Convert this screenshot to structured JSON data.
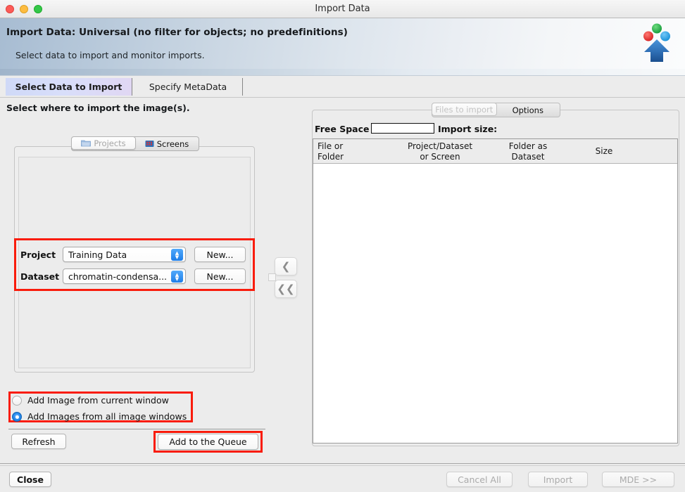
{
  "window": {
    "title": "Import Data",
    "traffic_lights": [
      "close-red",
      "minimize-yellow",
      "zoom-green"
    ]
  },
  "banner": {
    "title": "Import Data: Universal  (no filter for objects; no predefinitions)",
    "subtitle": "Select data to import and monitor imports.",
    "logo_name": "omero-logo"
  },
  "tabs": [
    {
      "label": "Select Data to Import",
      "selected": true
    },
    {
      "label": "Specify MetaData",
      "selected": false
    }
  ],
  "left": {
    "hint": "Select where to import the image(s).",
    "segmented": [
      {
        "label": "Projects",
        "icon": "folder-icon",
        "selected": true
      },
      {
        "label": "Screens",
        "icon": "screen-icon",
        "selected": false
      }
    ],
    "project": {
      "label": "Project",
      "value": "Training Data",
      "new_button": "New..."
    },
    "dataset": {
      "label": "Dataset",
      "value": "chromatin-condensa...",
      "new_button": "New..."
    },
    "radios": [
      {
        "label": "Add Image from current window",
        "selected": false
      },
      {
        "label": "Add Images from all image windows",
        "selected": true
      }
    ],
    "refresh_button": "Refresh",
    "add_queue_button": "Add to the Queue"
  },
  "middle": {
    "move_one": "❮",
    "move_all": "❮❮"
  },
  "right": {
    "segmented": [
      {
        "label": "Files to import",
        "selected": true
      },
      {
        "label": "Options",
        "selected": false
      }
    ],
    "free_space_label": "Free Space",
    "free_space_value": "",
    "import_size_label": "Import size:",
    "columns": [
      {
        "line1": "File or",
        "line2": "Folder"
      },
      {
        "line1": "Project/Dataset",
        "line2": "or Screen"
      },
      {
        "line1": "Folder as",
        "line2": "Dataset"
      },
      {
        "line1": "Size",
        "line2": ""
      }
    ],
    "rows": []
  },
  "footer": {
    "close_button": "Close",
    "cancel_all_button": "Cancel All",
    "import_button": "Import",
    "mde_button": "MDE >>"
  },
  "colors": {
    "highlight": "#f91c0c",
    "accent_blue": "#1f7ee8",
    "tab_selected": "#d8defa"
  }
}
